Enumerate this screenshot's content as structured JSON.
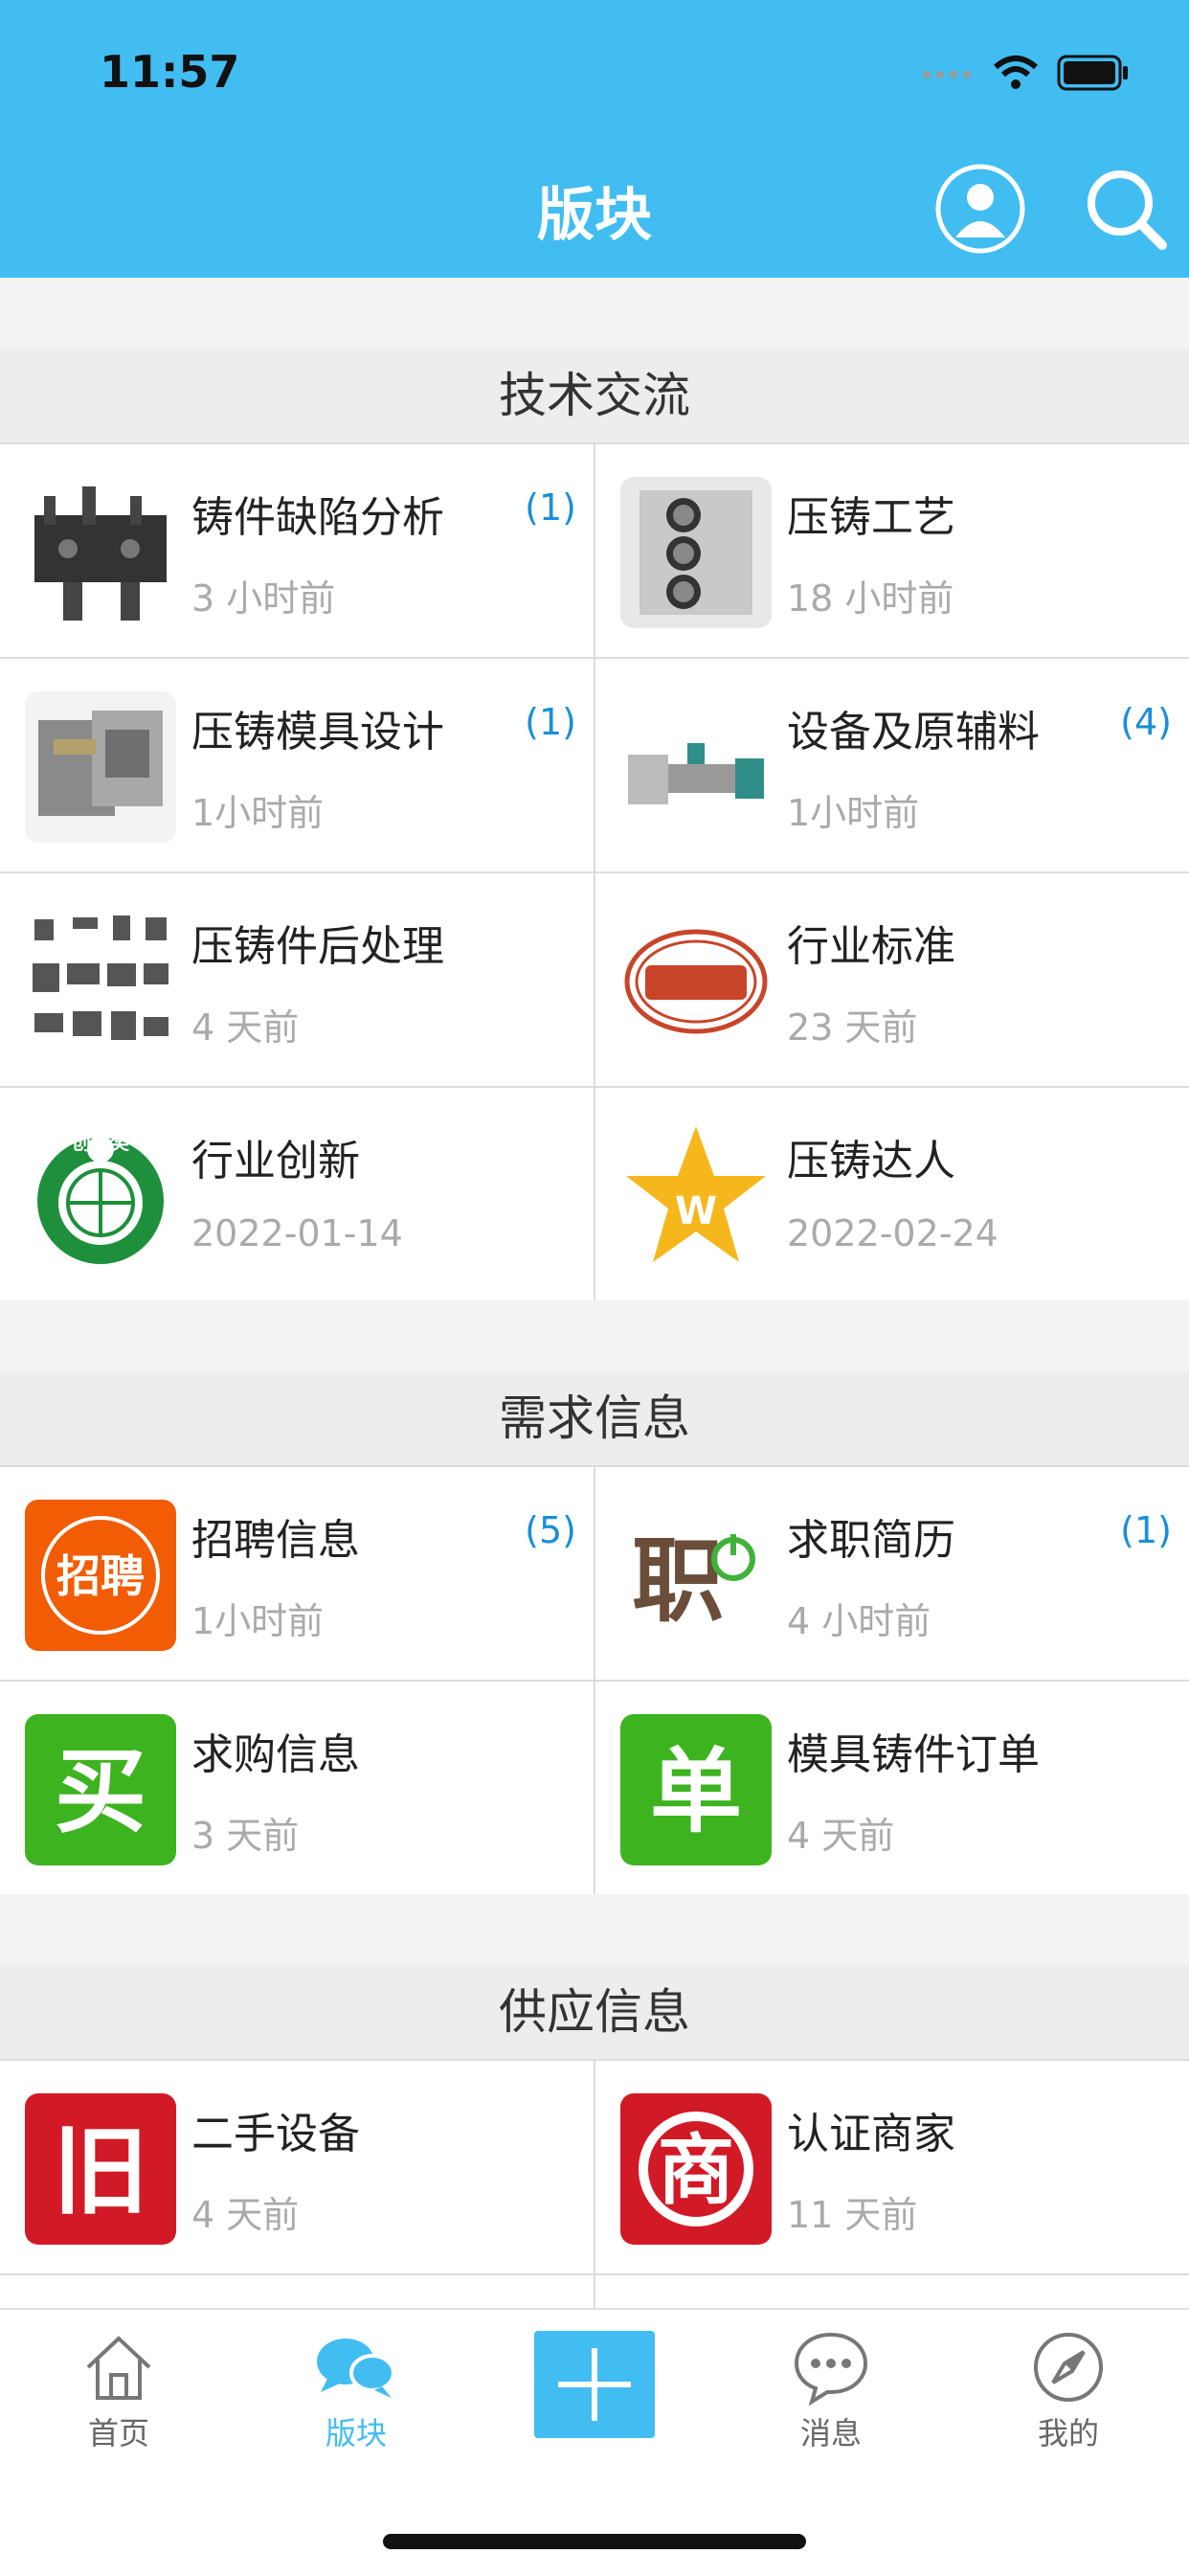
{
  "status": {
    "time": "11:57"
  },
  "header": {
    "title": "版块"
  },
  "sections": [
    {
      "title": "技术交流",
      "items": [
        {
          "name": "铸件缺陷分析",
          "count": "(1)",
          "time": "3 小时前",
          "icon": "casting-defect-image"
        },
        {
          "name": "压铸工艺",
          "count": "",
          "time": "18 小时前",
          "icon": "engine-block-image"
        },
        {
          "name": "压铸模具设计",
          "count": "(1)",
          "time": "1小时前",
          "icon": "mold-image"
        },
        {
          "name": "设备及原辅料",
          "count": "(4)",
          "time": "1小时前",
          "icon": "machine-image"
        },
        {
          "name": "压铸件后处理",
          "count": "",
          "time": "4 天前",
          "icon": "parts-image"
        },
        {
          "name": "行业标准",
          "count": "",
          "time": "23 天前",
          "icon": "gb-logo"
        },
        {
          "name": "行业创新",
          "count": "",
          "time": "2022-01-14",
          "icon": "innovation-logo",
          "logo_text": "创新奖"
        },
        {
          "name": "压铸达人",
          "count": "",
          "time": "2022-02-24",
          "icon": "star-crown-icon",
          "logo_text": "W"
        }
      ]
    },
    {
      "title": "需求信息",
      "items": [
        {
          "name": "招聘信息",
          "count": "(5)",
          "time": "1小时前",
          "icon": "recruit-logo",
          "logo_text": "招聘"
        },
        {
          "name": "求职简历",
          "count": "(1)",
          "time": "4 小时前",
          "icon": "job-logo",
          "logo_text": "职"
        },
        {
          "name": "求购信息",
          "count": "",
          "time": "3 天前",
          "icon": "buy-logo",
          "logo_text": "买"
        },
        {
          "name": "模具铸件订单",
          "count": "",
          "time": "4 天前",
          "icon": "order-logo",
          "logo_text": "单"
        }
      ]
    },
    {
      "title": "供应信息",
      "items": [
        {
          "name": "二手设备",
          "count": "",
          "time": "4 天前",
          "icon": "used-logo",
          "logo_text": "旧"
        },
        {
          "name": "认证商家",
          "count": "",
          "time": "11 天前",
          "icon": "merchant-logo",
          "logo_text": "商"
        },
        {
          "name": "",
          "count": "",
          "time": "",
          "icon": ""
        },
        {
          "name": "",
          "count": "",
          "time": "",
          "icon": ""
        }
      ]
    }
  ],
  "tabbar": {
    "items": [
      {
        "label": "首页",
        "icon": "home-icon"
      },
      {
        "label": "版块",
        "icon": "chat-bubbles-icon",
        "active": true
      },
      {
        "label": "",
        "icon": "plus-icon"
      },
      {
        "label": "消息",
        "icon": "message-icon"
      },
      {
        "label": "我的",
        "icon": "compass-icon"
      }
    ]
  },
  "colors": {
    "accent": "#41bdf2",
    "count": "#1a8fd8"
  }
}
